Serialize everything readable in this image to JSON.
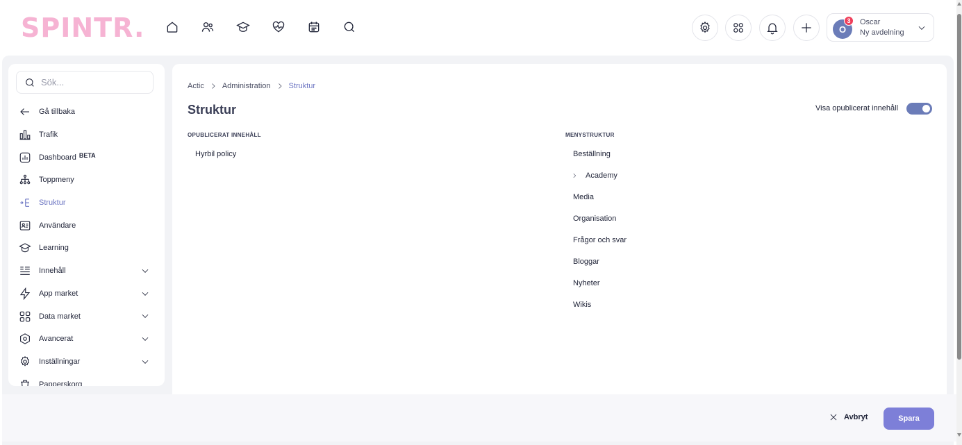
{
  "header": {
    "logo_text": "SPINTR.",
    "nav_icons": [
      "home-icon",
      "people-icon",
      "graduation-cap-icon",
      "heart-pulse-icon",
      "calendar-icon",
      "search-icon"
    ],
    "action_icons": [
      "gear-icon",
      "apps-grid-icon",
      "bell-icon",
      "plus-icon"
    ],
    "user": {
      "initial": "O",
      "badge_count": "3",
      "name": "Oscar",
      "department": "Ny avdelning"
    }
  },
  "sidebar": {
    "search_placeholder": "Sök...",
    "items": [
      {
        "label": "Gå tillbaka",
        "icon": "arrow-left-icon"
      },
      {
        "label": "Trafik",
        "icon": "bar-chart-icon"
      },
      {
        "label": "Dashboard",
        "badge": "BETA",
        "icon": "dashboard-icon"
      },
      {
        "label": "Toppmeny",
        "icon": "hierarchy-icon"
      },
      {
        "label": "Struktur",
        "icon": "structure-icon",
        "active": true
      },
      {
        "label": "Användare",
        "icon": "id-card-icon"
      },
      {
        "label": "Learning",
        "icon": "graduation-cap-icon"
      },
      {
        "label": "Innehåll",
        "icon": "content-list-icon",
        "expandable": true
      },
      {
        "label": "App market",
        "icon": "lightning-icon",
        "expandable": true
      },
      {
        "label": "Data market",
        "icon": "grid-icon",
        "expandable": true
      },
      {
        "label": "Avancerat",
        "icon": "hexagon-icon",
        "expandable": true
      },
      {
        "label": "Inställningar",
        "icon": "gear-icon",
        "expandable": true
      },
      {
        "label": "Papperskorg",
        "icon": "trash-icon"
      }
    ]
  },
  "main": {
    "breadcrumb": [
      "Actic",
      "Administration",
      "Struktur"
    ],
    "title": "Struktur",
    "toggle": {
      "label": "Visa opublicerat innehåll",
      "on": true
    },
    "unpublished": {
      "heading": "OPUBLICERAT INNEHÅLL",
      "items": [
        "Hyrbil policy"
      ]
    },
    "menu_structure": {
      "heading": "MENYSTRUKTUR",
      "items": [
        {
          "label": "Beställning"
        },
        {
          "label": "Academy",
          "has_children": true
        },
        {
          "label": "Media"
        },
        {
          "label": "Organisation"
        },
        {
          "label": "Frågor och svar"
        },
        {
          "label": "Bloggar"
        },
        {
          "label": "Nyheter"
        },
        {
          "label": "Wikis"
        }
      ]
    }
  },
  "footer": {
    "cancel_label": "Avbryt",
    "save_label": "Spara"
  },
  "colors": {
    "accent": "#6b74c2",
    "save_button": "#7d7fd8",
    "logo": "#f6b3d3",
    "avatar": "#6b7cb8",
    "badge": "#ef3f5b"
  }
}
